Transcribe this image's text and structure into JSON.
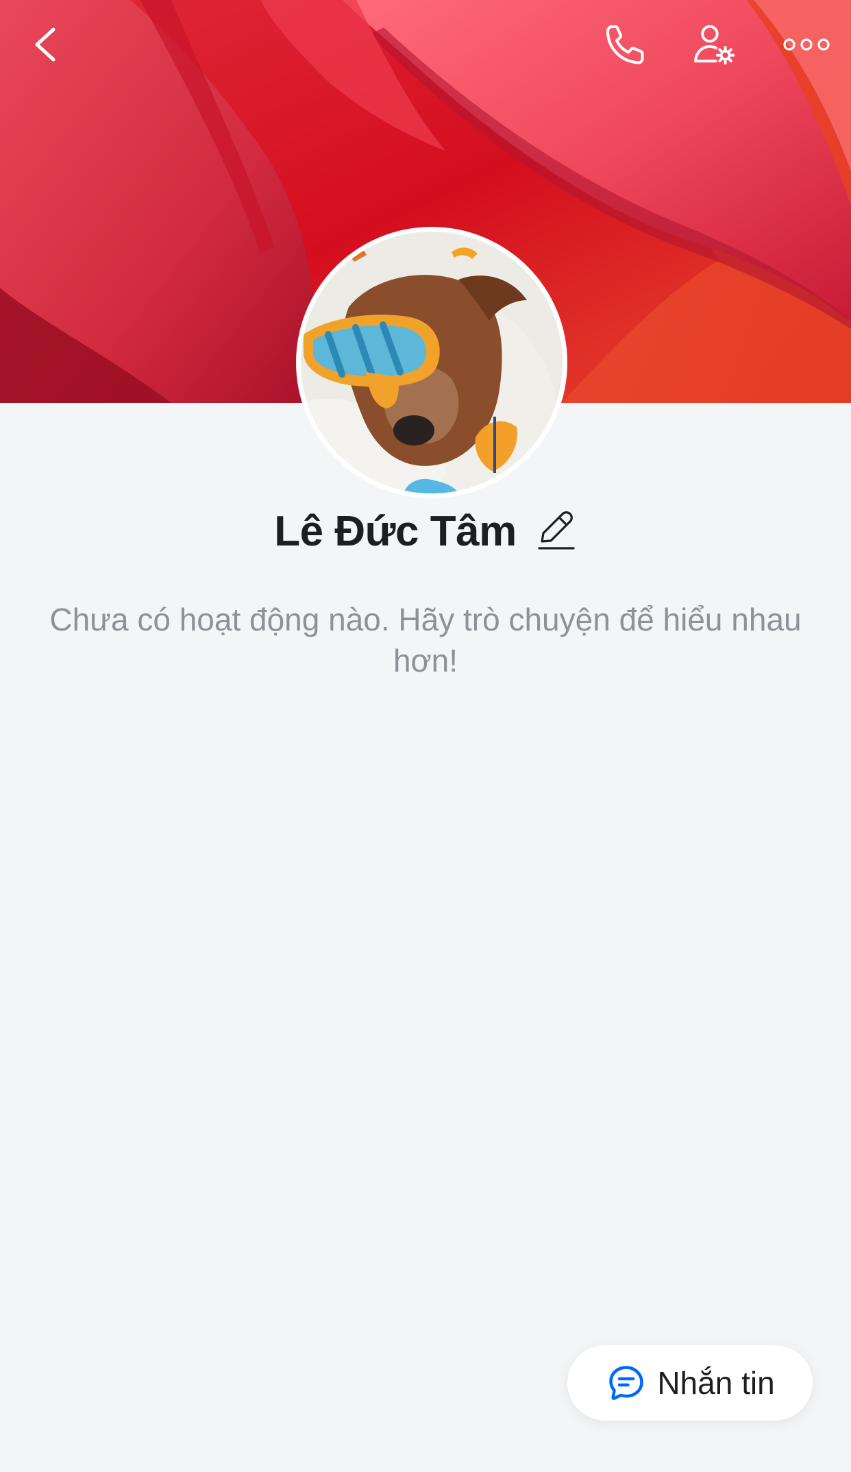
{
  "header": {
    "back_icon": "chevron-left-icon",
    "call_icon": "phone-icon",
    "friend_settings_icon": "user-gear-icon",
    "more_icon": "more-dots-icon"
  },
  "cover": {
    "description_colors": [
      "#d9142b",
      "#f04a5c",
      "#b50f22"
    ]
  },
  "profile": {
    "name": "Lê Đức Tâm",
    "edit_icon": "pencil-icon"
  },
  "activity": {
    "empty_message": "Chưa có hoạt động nào. Hãy trò chuyện để hiểu nhau hơn!"
  },
  "actions": {
    "message_label": "Nhắn tin",
    "message_icon": "chat-bubble-icon"
  },
  "colors": {
    "accent": "#0068ff",
    "background": "#f4f5f7",
    "name_text": "#1c1e21",
    "muted_text": "#8d9298"
  }
}
